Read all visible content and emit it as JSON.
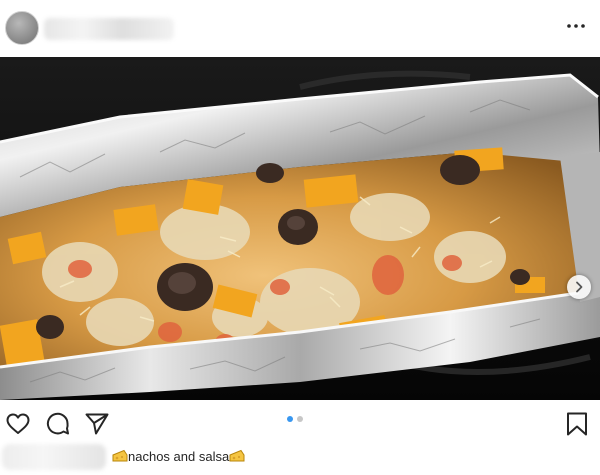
{
  "post": {
    "header": {
      "avatar_icon": "avatar-icon",
      "username_blurred": true,
      "more_icon": "more-options-icon"
    },
    "photo": {
      "carousel_next_icon": "chevron-right-icon"
    },
    "actions": {
      "like_icon": "heart-icon",
      "comment_icon": "comment-icon",
      "share_icon": "paper-plane-icon",
      "save_icon": "bookmark-icon"
    },
    "carousel": {
      "count": 2,
      "active_index": 0
    },
    "caption": {
      "author_blurred": true,
      "text": "nachos and salsa",
      "leading_emoji": "cheese-icon",
      "trailing_emoji": "cheese-icon"
    },
    "colors": {
      "accent_dot": "#3897f0",
      "inactive_dot": "#c7c7c7",
      "text": "#262626"
    }
  }
}
